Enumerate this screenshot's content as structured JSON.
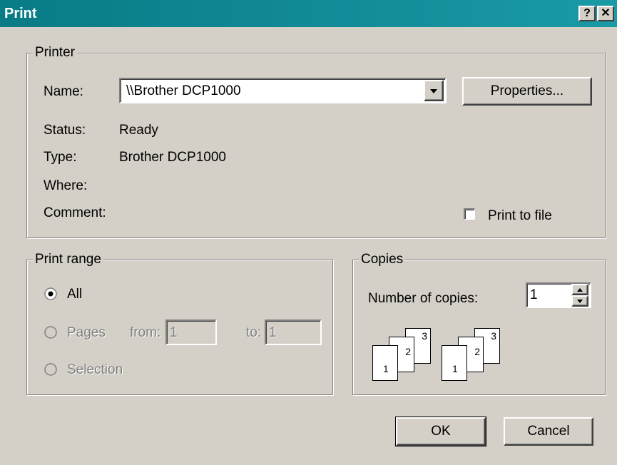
{
  "window": {
    "title": "Print",
    "help_label": "?",
    "close_label": "✕"
  },
  "printer": {
    "group_label": "Printer",
    "name_label": "Name:",
    "name_value": "\\\\Brother DCP1000",
    "properties_label": "Properties...",
    "status_label": "Status:",
    "status_value": "Ready",
    "type_label": "Type:",
    "type_value": "Brother DCP1000",
    "where_label": "Where:",
    "comment_label": "Comment:",
    "print_to_file_label": "Print to file"
  },
  "print_range": {
    "group_label": "Print range",
    "all_label": "All",
    "pages_label": "Pages",
    "from_label": "from:",
    "from_value": "1",
    "to_label": "to:",
    "to_value": "1",
    "selection_label": "Selection"
  },
  "copies": {
    "group_label": "Copies",
    "number_label": "Number of copies:",
    "number_value": "1",
    "page_1": "1",
    "page_2": "2",
    "page_3": "3"
  },
  "buttons": {
    "ok_label": "OK",
    "cancel_label": "Cancel"
  },
  "colors": {
    "titlebar": "#087b86",
    "face": "#d4d0c8"
  }
}
